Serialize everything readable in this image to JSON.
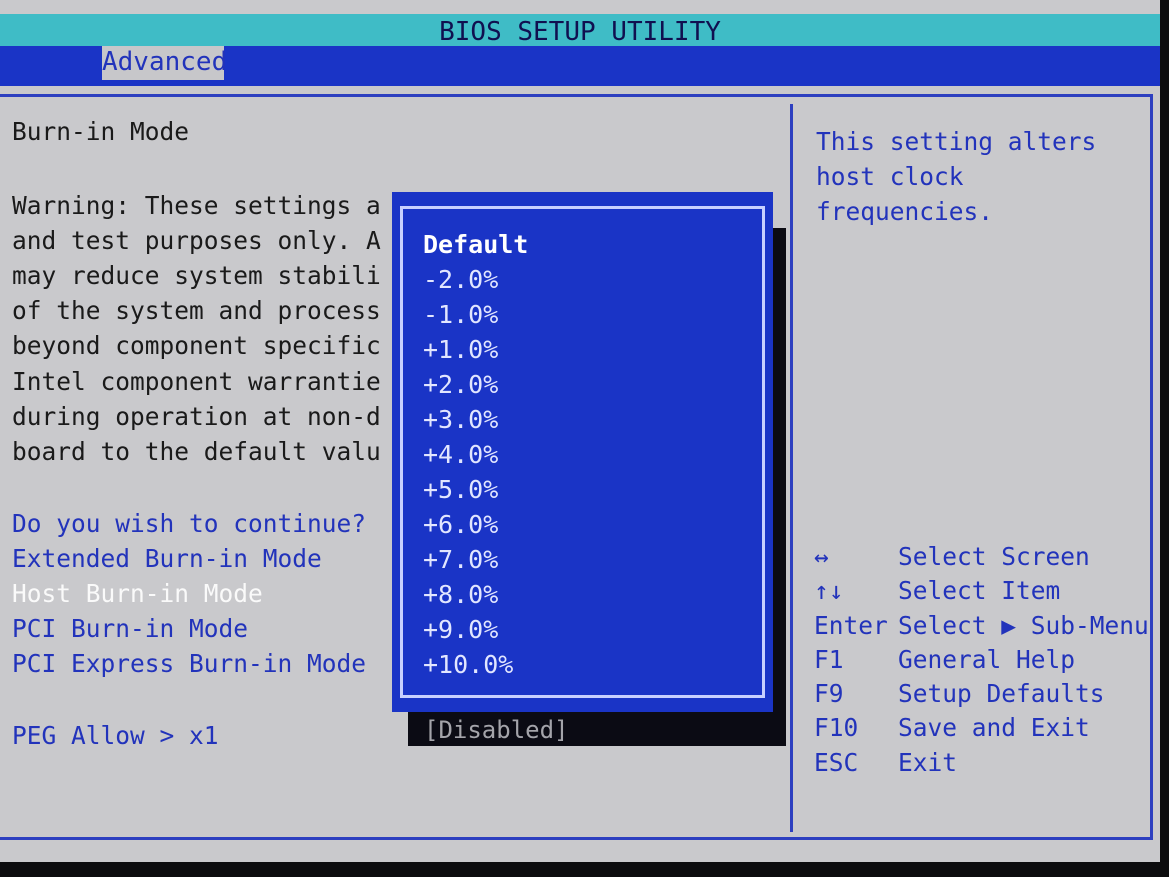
{
  "title": "BIOS SETUP UTILITY",
  "tabs": [
    {
      "label": "Advanced"
    }
  ],
  "left": {
    "heading": "Burn-in Mode",
    "warning": [
      "Warning: These settings a",
      "and test purposes only. A",
      "may reduce system stabili",
      "of the system and process",
      "beyond component specific",
      "Intel component warrantie",
      "during operation at non-d",
      "board to the default valu"
    ],
    "options": [
      {
        "label": "Do you wish to continue?"
      },
      {
        "label": "Extended Burn-in Mode"
      },
      {
        "label": "Host Burn-in Mode"
      },
      {
        "label": "PCI Burn-in Mode"
      },
      {
        "label": "PCI Express Burn-in Mode"
      }
    ],
    "peg": "PEG Allow > x1",
    "disabled_value": "[Disabled]"
  },
  "popup": {
    "items": [
      "Default",
      "-2.0%",
      "-1.0%",
      "+1.0%",
      "+2.0%",
      "+3.0%",
      "+4.0%",
      "+5.0%",
      "+6.0%",
      "+7.0%",
      "+8.0%",
      "+9.0%",
      "+10.0%"
    ]
  },
  "help": {
    "lines": [
      "This setting alters",
      "host clock",
      "frequencies."
    ]
  },
  "keys": [
    {
      "key": "↔",
      "action": "Select Screen"
    },
    {
      "key": "↑↓",
      "action": "Select Item"
    },
    {
      "key": "Enter",
      "action": "Select ▶ Sub-Menu"
    },
    {
      "key": "F1",
      "action": "General Help"
    },
    {
      "key": "F9",
      "action": "Setup Defaults"
    },
    {
      "key": "F10",
      "action": "Save and Exit"
    },
    {
      "key": "ESC",
      "action": "Exit"
    }
  ],
  "colors": {
    "title_bar": "#3fbcc6",
    "menu_bar": "#1a34c6",
    "panel": "#c9c9cc",
    "accent_text": "#2233bb",
    "popup": "#1a34c6"
  }
}
